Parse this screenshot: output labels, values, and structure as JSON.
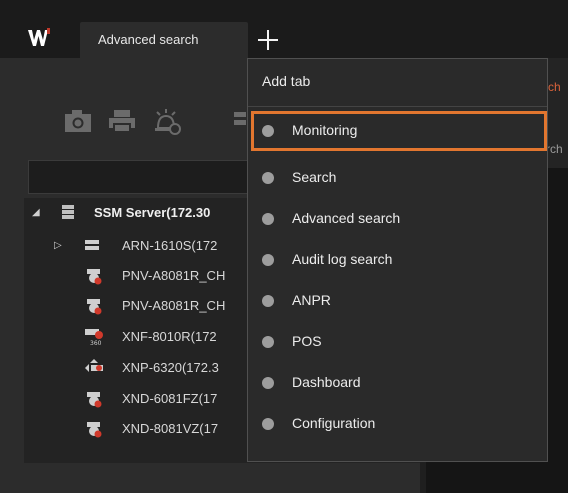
{
  "tabs": {
    "active_label": "Advanced search"
  },
  "dropdown": {
    "header": "Add tab",
    "items": [
      "Monitoring",
      "Search",
      "Advanced search",
      "Audit log search",
      "ANPR",
      "POS",
      "Dashboard",
      "Configuration"
    ],
    "selected_index": 0
  },
  "right_panel": {
    "text1": "ch",
    "text2": "rch"
  },
  "tree": {
    "server": "SSM Server(172.30",
    "recorder": "ARN-1610S(172",
    "devices": [
      "PNV-A8081R_CH",
      "PNV-A8081R_CH",
      "XNF-8010R(172",
      "XNP-6320(172.3",
      "XND-6081FZ(17",
      "XND-8081VZ(17"
    ]
  },
  "colors": {
    "accent": "#e2762f",
    "logo": "#ffffff",
    "logo_mark": "#c0392b"
  }
}
